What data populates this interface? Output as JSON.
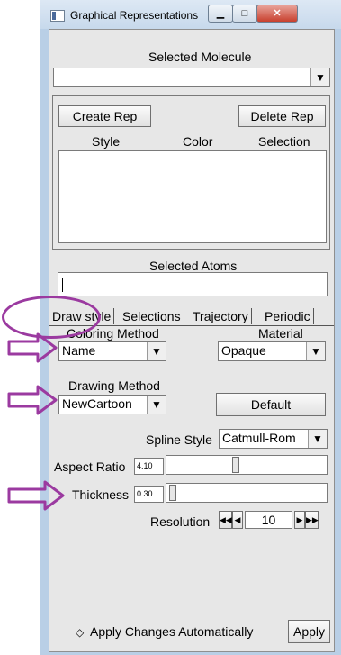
{
  "window": {
    "title": "Graphical Representations"
  },
  "molecule": {
    "heading": "Selected Molecule",
    "value": ""
  },
  "reps": {
    "create_label": "Create Rep",
    "delete_label": "Delete Rep",
    "headers": [
      "Style",
      "Color",
      "Selection"
    ]
  },
  "atoms": {
    "heading": "Selected Atoms",
    "value": ""
  },
  "tabs": [
    "Draw style",
    "Selections",
    "Trajectory",
    "Periodic"
  ],
  "coloring": {
    "label": "Coloring Method",
    "value": "Name"
  },
  "material": {
    "label": "Material",
    "value": "Opaque"
  },
  "drawing": {
    "label": "Drawing Method",
    "value": "NewCartoon"
  },
  "default_label": "Default",
  "spline": {
    "label": "Spline Style",
    "value": "Catmull-Rom"
  },
  "aspect": {
    "label": "Aspect Ratio",
    "value": "4.10",
    "slider_fraction": 0.43
  },
  "thickness": {
    "label": "Thickness",
    "value": "0.30",
    "slider_fraction": 0.02
  },
  "resolution": {
    "label": "Resolution",
    "value": "10"
  },
  "apply_auto_label": "Apply Changes Automatically",
  "apply_label": "Apply",
  "colors": {
    "annotation": "#9b3aa0",
    "titlebar": "#c7d9ec"
  }
}
